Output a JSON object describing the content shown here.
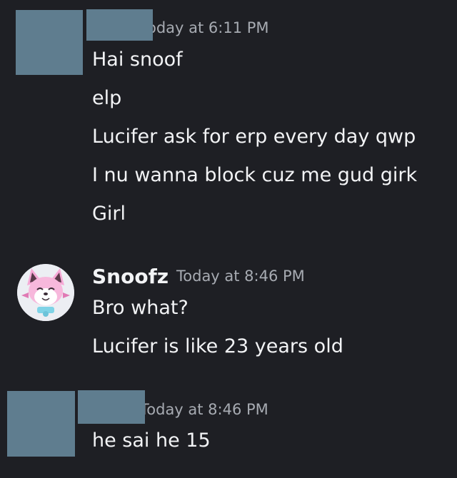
{
  "group1": {
    "timestamp": "oday at 6:11 PM",
    "messages": [
      "Hai snoof",
      "elp",
      "Lucifer ask for erp every day qwp",
      "I nu wanna block cuz me gud girk",
      "Girl"
    ]
  },
  "group2": {
    "username": "Snoofz",
    "timestamp": "Today at 8:46 PM",
    "messages": [
      "Bro what?",
      "Lucifer is like 23 years old"
    ]
  },
  "group3": {
    "timestamp": "Today at 8:46 PM",
    "messages": [
      "he sai he 15"
    ]
  },
  "colors": {
    "background": "#1e1f24",
    "redaction": "#5f7d8f",
    "text": "#f2f3f5",
    "timestamp": "#a7abb2"
  }
}
